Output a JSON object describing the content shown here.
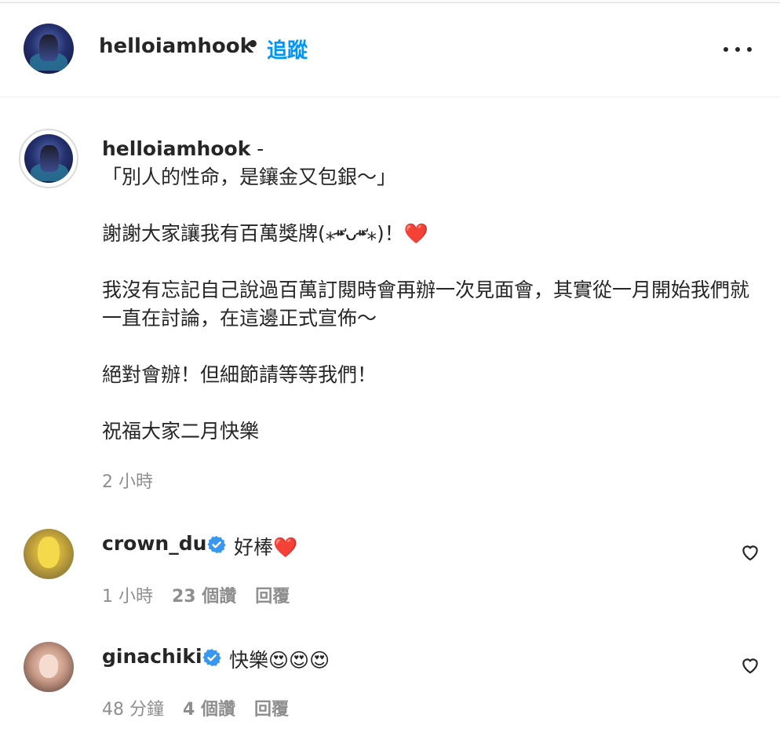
{
  "header": {
    "username": "helloiamhook",
    "dot": "•",
    "follow_label": "追蹤"
  },
  "caption": {
    "username": "helloiamhook",
    "separator": "-",
    "line1": "「別人的性命，是鑲金又包銀～」",
    "line2": "謝謝大家讓我有百萬獎牌(⁎⁍̴̛ᴗ⁍̴̛⁎)！❤️",
    "line3": "我沒有忘記自己說過百萬訂閱時會再辦一次見面會，其實從一月開始我們就一直在討論，在這邊正式宣佈～",
    "line4": "絕對會辦！但細節請等等我們！",
    "line5": "祝福大家二月快樂",
    "time": "2 小時"
  },
  "comments": [
    {
      "username": "crown_du",
      "text": "好棒❤️",
      "time": "1 小時",
      "likes": "23 個讚",
      "reply": "回覆"
    },
    {
      "username": "ginachiki",
      "text": "快樂😍😍😍",
      "time": "48 分鐘",
      "likes": "4 個讚",
      "reply": "回覆"
    }
  ],
  "icons": {
    "more": "more-options-icon",
    "verified": "verified-badge-icon",
    "like": "heart-outline-icon"
  },
  "colors": {
    "accent": "#0095f6",
    "verified": "#3897f0",
    "text": "#262626",
    "muted": "#8e8e8e"
  }
}
